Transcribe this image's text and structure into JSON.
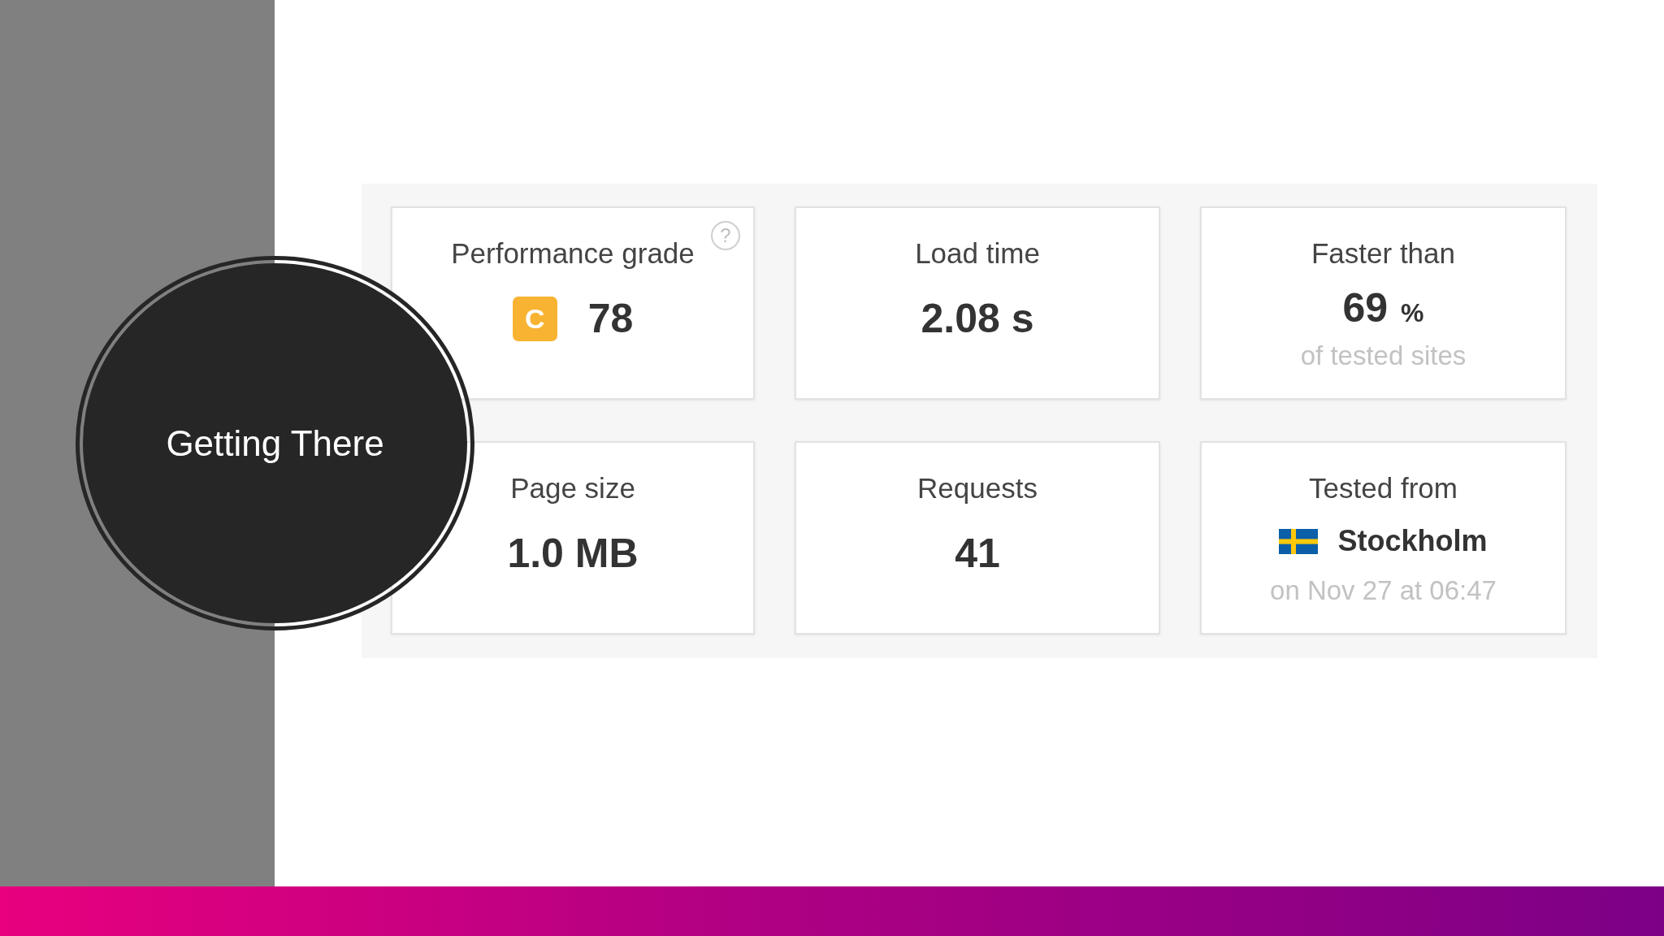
{
  "slide": {
    "title": "Getting There"
  },
  "metrics": [
    {
      "kind": "grade",
      "label": "Performance grade",
      "help": "?",
      "grade": "C",
      "value": "78"
    },
    {
      "kind": "value",
      "label": "Load time",
      "value": "2.08 s"
    },
    {
      "kind": "percent",
      "label": "Faster than",
      "value": "69",
      "unit": "%",
      "note": "of tested sites"
    },
    {
      "kind": "value",
      "label": "Page size",
      "value": "1.0 MB"
    },
    {
      "kind": "value",
      "label": "Requests",
      "value": "41"
    },
    {
      "kind": "location",
      "label": "Tested from",
      "value": "Stockholm",
      "note": "on Nov 27 at 06:47"
    }
  ]
}
